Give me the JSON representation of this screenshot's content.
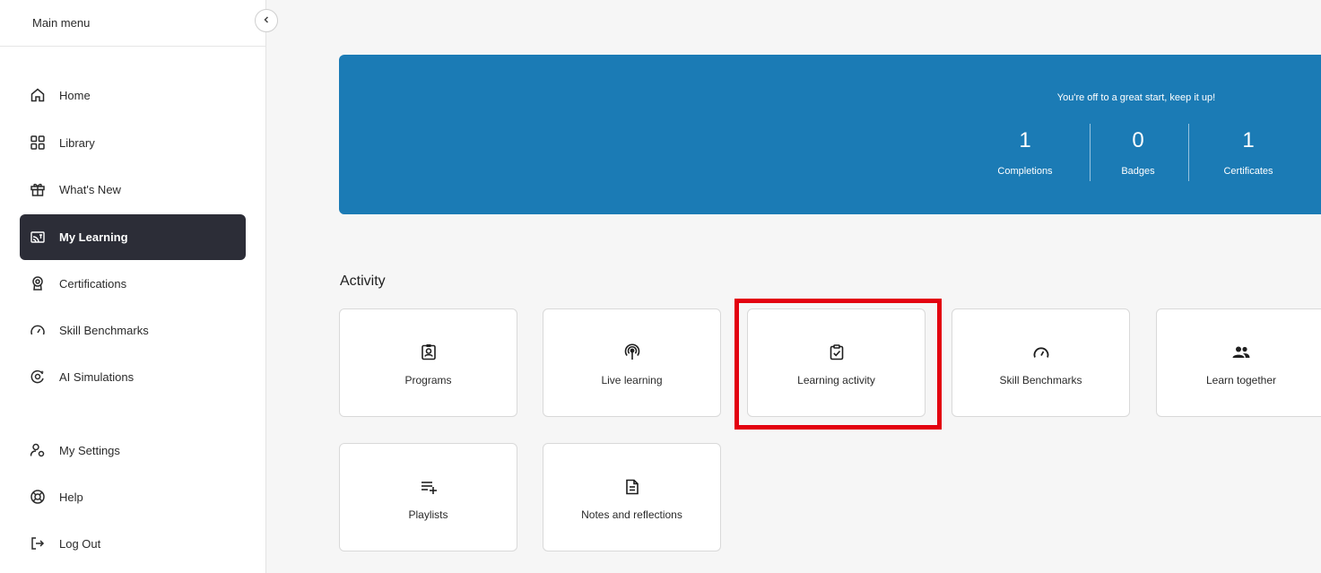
{
  "sidebar": {
    "title": "Main menu",
    "collapse_icon": "chevron-left-icon",
    "items": [
      {
        "label": "Home",
        "icon": "home-icon"
      },
      {
        "label": "Library",
        "icon": "grid-icon"
      },
      {
        "label": "What's New",
        "icon": "gift-icon"
      },
      {
        "label": "My Learning",
        "icon": "my-learning-icon",
        "active": true
      },
      {
        "label": "Certifications",
        "icon": "award-icon"
      },
      {
        "label": "Skill Benchmarks",
        "icon": "gauge-icon"
      },
      {
        "label": "AI Simulations",
        "icon": "ai-simulation-icon"
      },
      {
        "label": "My Settings",
        "icon": "user-settings-icon"
      },
      {
        "label": "Help",
        "icon": "help-icon"
      },
      {
        "label": "Log Out",
        "icon": "log-out-icon"
      }
    ]
  },
  "banner": {
    "message": "You're off to a great start, keep it up!",
    "stats": [
      {
        "value": "1",
        "label": "Completions"
      },
      {
        "value": "0",
        "label": "Badges"
      },
      {
        "value": "1",
        "label": "Certificates"
      }
    ],
    "color": "#1b7bb5"
  },
  "activity": {
    "title": "Activity",
    "cards": [
      {
        "label": "Programs",
        "icon": "program-icon"
      },
      {
        "label": "Live learning",
        "icon": "broadcast-icon"
      },
      {
        "label": "Learning activity",
        "icon": "clipboard-check-icon",
        "highlighted": true
      },
      {
        "label": "Skill Benchmarks",
        "icon": "gauge-icon"
      },
      {
        "label": "Learn together",
        "icon": "group-icon"
      },
      {
        "label": "Playlists",
        "icon": "playlist-add-icon"
      },
      {
        "label": "Notes and reflections",
        "icon": "note-icon"
      }
    ]
  },
  "colors": {
    "accent": "#1b7bb5",
    "active_nav": "#2c2d37",
    "highlight": "#e3000f"
  }
}
